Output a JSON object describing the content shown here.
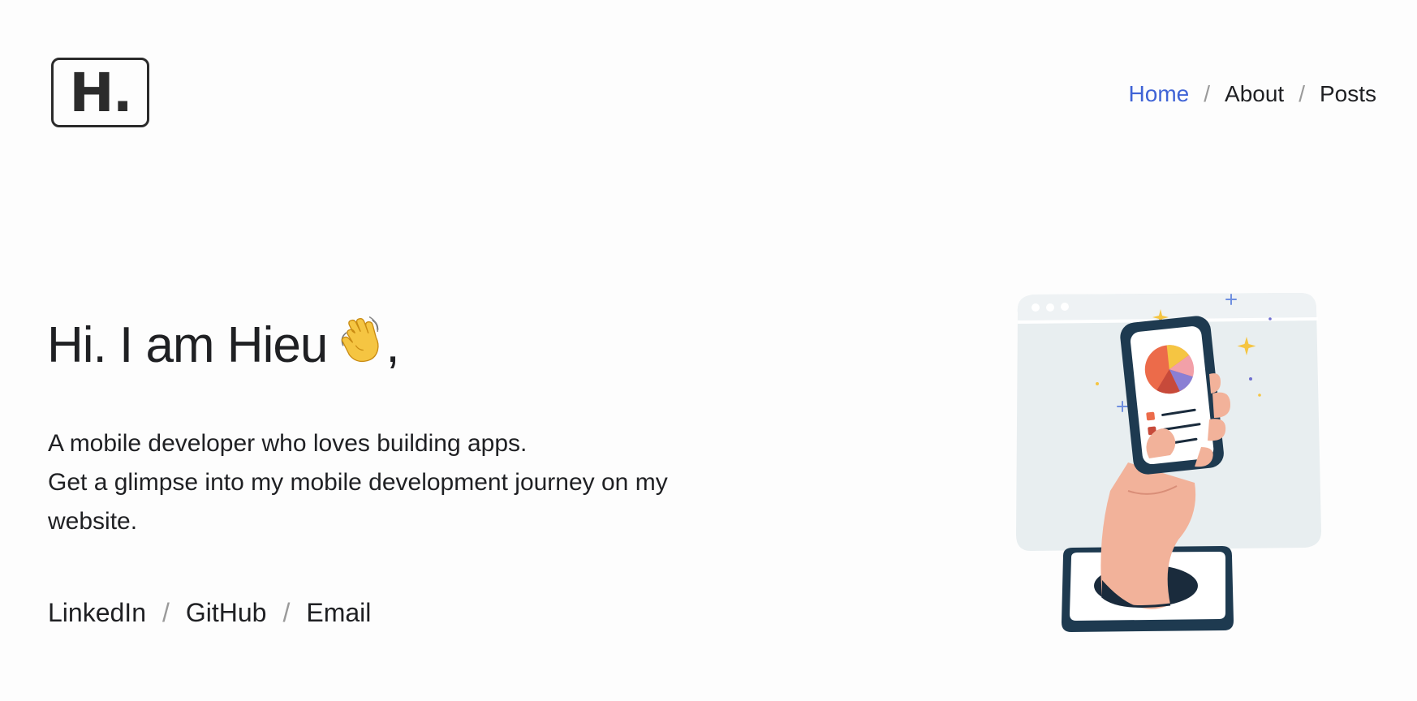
{
  "header": {
    "logo_text": "H.",
    "nav": [
      {
        "label": "Home",
        "active": true
      },
      {
        "label": "About",
        "active": false
      },
      {
        "label": "Posts",
        "active": false
      }
    ],
    "separator": "/"
  },
  "hero": {
    "greeting": "Hi. I am Hieu",
    "greeting_suffix": ",",
    "wave_icon": "waving-hand-icon",
    "intro_line_1": "A mobile developer who loves building apps.",
    "intro_line_2": "Get a glimpse into my mobile development journey on my website."
  },
  "social": {
    "links": [
      "LinkedIn",
      "GitHub",
      "Email"
    ],
    "separator": "/"
  },
  "colors": {
    "accent": "#3f63d6",
    "text": "#1f2023",
    "separator": "#9a9a9a",
    "background": "#fdfdfd"
  }
}
